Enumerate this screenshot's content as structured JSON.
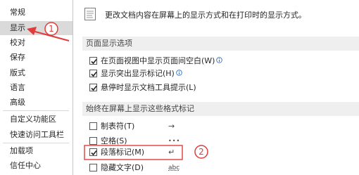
{
  "nav": {
    "items": [
      "常规",
      "显示",
      "校对",
      "保存",
      "版式",
      "语言",
      "高级",
      "自定义功能区",
      "快速访问工具栏",
      "加载项",
      "信任中心"
    ],
    "selected": "显示"
  },
  "header": {
    "description": "更改文档内容在屏幕上的显示方式和在打印时的显示方式。"
  },
  "page_display": {
    "title": "页面显示选项",
    "options": [
      {
        "label": "在页面视图中显示页面间空白(W)",
        "checked": true,
        "info": true
      },
      {
        "label": "显示突出显示标记(H)",
        "checked": true,
        "info": true
      },
      {
        "label": "悬停时显示文档工具提示(L)",
        "checked": true,
        "info": false
      }
    ]
  },
  "format_marks": {
    "title": "始终在屏幕上显示这些格式标记",
    "options": [
      {
        "label": "制表符(T)",
        "checked": false,
        "symbol": "→"
      },
      {
        "label": "空格(S)",
        "checked": false,
        "symbol": "•••"
      },
      {
        "label": "段落标记(M)",
        "checked": true,
        "symbol": "↵"
      },
      {
        "label": "隐藏文字(D)",
        "checked": false,
        "symbol": "abc"
      }
    ]
  },
  "annotations": {
    "badge_1": "1",
    "badge_2": "2",
    "color": "#e03c3c"
  },
  "colors": {
    "nav_selected_bg": "#dadada",
    "section_bg": "#efefef",
    "info_icon": "#2b6fc2"
  }
}
